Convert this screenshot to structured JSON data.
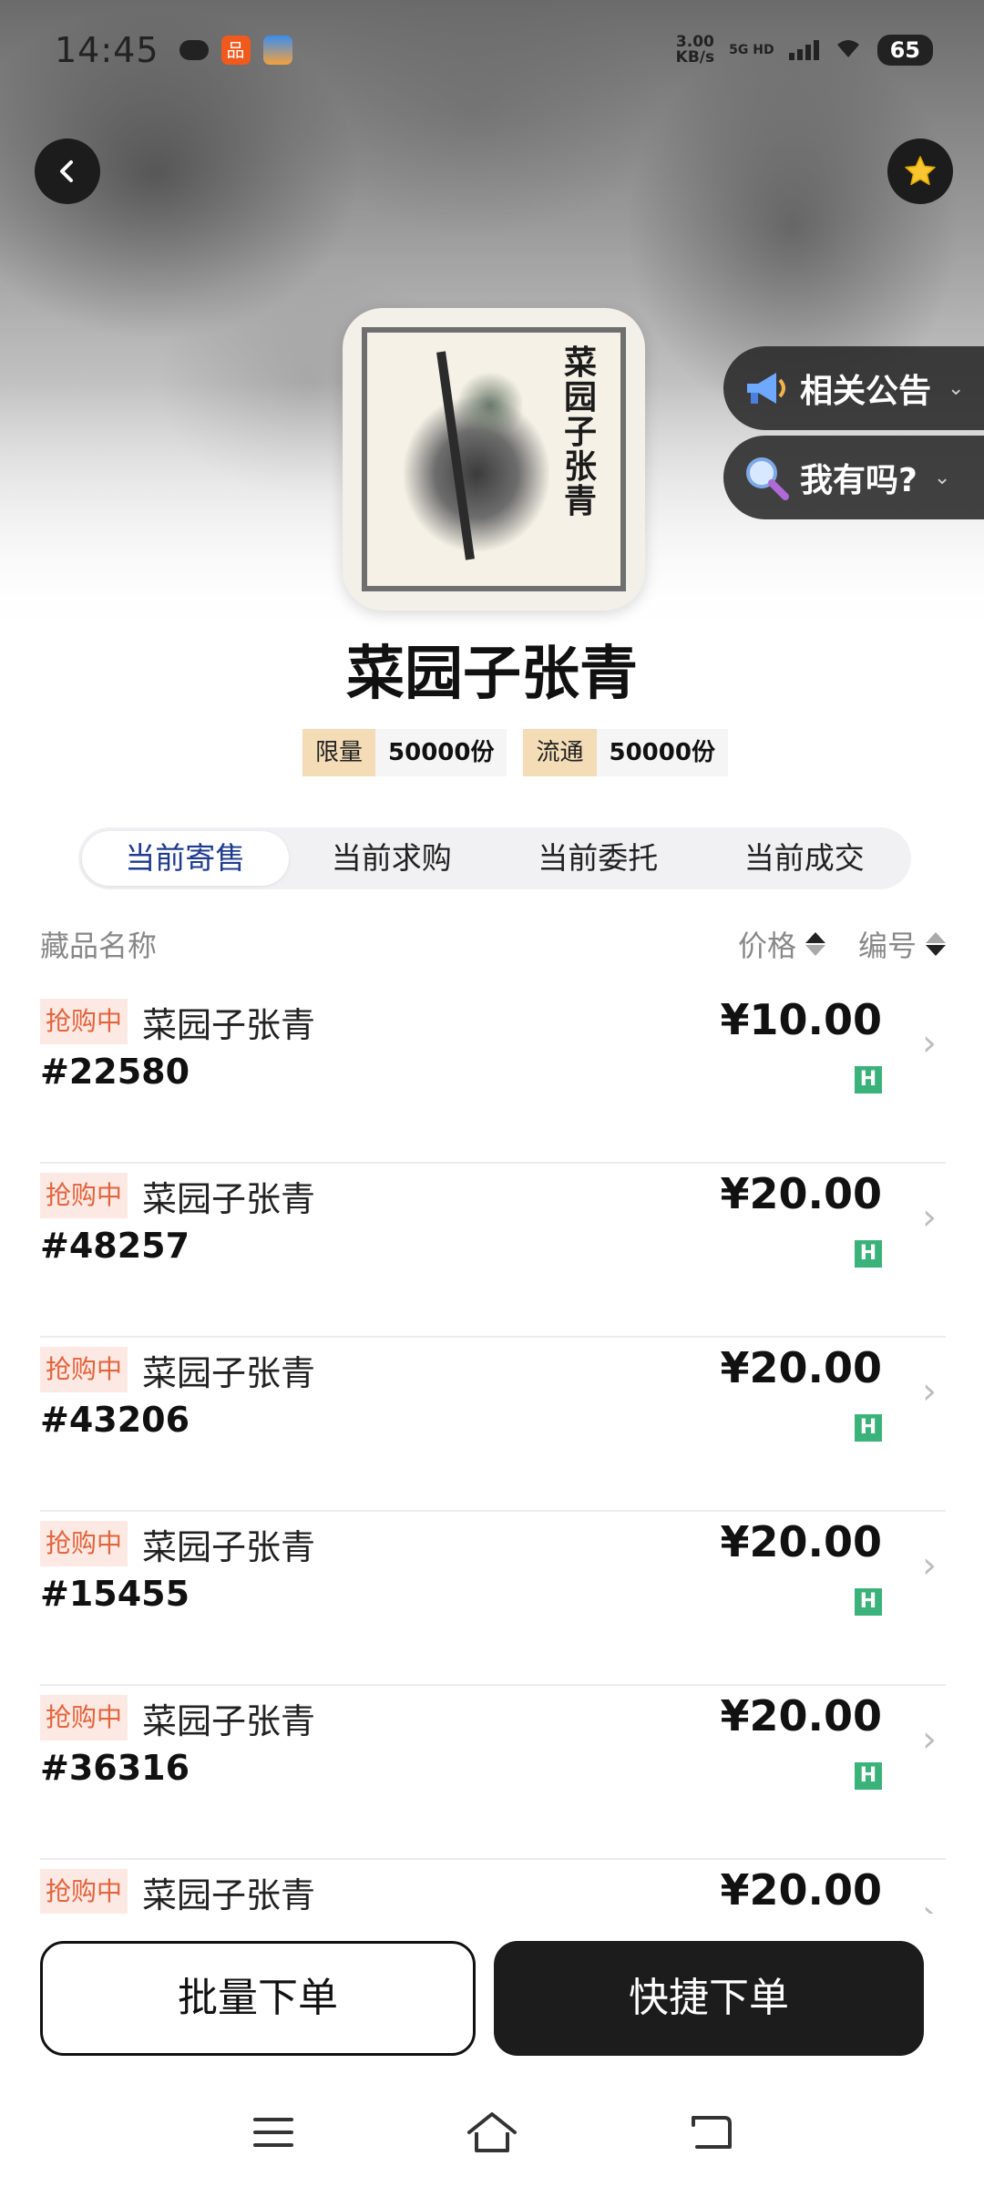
{
  "status_bar": {
    "time": "14:45",
    "app_icon_1_text": "品",
    "net_speed_top": "3.00",
    "net_speed_bottom": "KB/s",
    "network_type": "5G HD",
    "battery": "65"
  },
  "hero": {
    "artwork_calligraphy": "菜园子张青"
  },
  "side_pills": [
    {
      "label": "相关公告",
      "icon": "megaphone-icon"
    },
    {
      "label": "我有吗?",
      "icon": "magnifier-icon"
    }
  ],
  "product": {
    "title": "菜园子张青",
    "tags": [
      {
        "key": "限量",
        "value": "50000份"
      },
      {
        "key": "流通",
        "value": "50000份"
      }
    ]
  },
  "tabs": [
    {
      "label": "当前寄售",
      "active": true
    },
    {
      "label": "当前求购",
      "active": false
    },
    {
      "label": "当前委托",
      "active": false
    },
    {
      "label": "当前成交",
      "active": false
    }
  ],
  "list_header": {
    "name": "藏品名称",
    "price": "价格",
    "number": "编号"
  },
  "rows": [
    {
      "badge": "抢购中",
      "name": "菜园子张青",
      "serial": "#22580",
      "price": "¥10.00",
      "tag": "H"
    },
    {
      "badge": "抢购中",
      "name": "菜园子张青",
      "serial": "#48257",
      "price": "¥20.00",
      "tag": "H"
    },
    {
      "badge": "抢购中",
      "name": "菜园子张青",
      "serial": "#43206",
      "price": "¥20.00",
      "tag": "H"
    },
    {
      "badge": "抢购中",
      "name": "菜园子张青",
      "serial": "#15455",
      "price": "¥20.00",
      "tag": "H"
    },
    {
      "badge": "抢购中",
      "name": "菜园子张青",
      "serial": "#36316",
      "price": "¥20.00",
      "tag": "H"
    },
    {
      "badge": "抢购中",
      "name": "菜园子张青",
      "serial": "",
      "price": "¥20.00",
      "tag": ""
    }
  ],
  "actions": {
    "batch": "批量下单",
    "quick": "快捷下单"
  },
  "colors": {
    "accent_tab": "#1f3b8f",
    "badge_text": "#e2643c",
    "badge_bg": "#fde9e3",
    "h_tag": "#3bb27a",
    "tag_key_bg": "#f3dcb6",
    "dark": "#1c1c1c"
  }
}
